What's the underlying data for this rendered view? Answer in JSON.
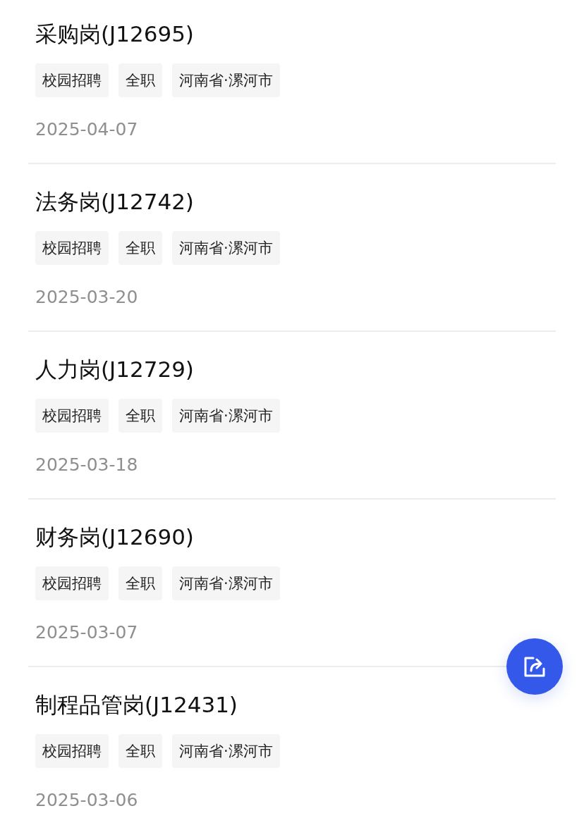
{
  "jobs": [
    {
      "title": "采购岗(J12695)",
      "tags": [
        "校园招聘",
        "全职",
        "河南省·漯河市"
      ],
      "date": "2025-04-07"
    },
    {
      "title": "法务岗(J12742)",
      "tags": [
        "校园招聘",
        "全职",
        "河南省·漯河市"
      ],
      "date": "2025-03-20"
    },
    {
      "title": "人力岗(J12729)",
      "tags": [
        "校园招聘",
        "全职",
        "河南省·漯河市"
      ],
      "date": "2025-03-18"
    },
    {
      "title": "财务岗(J12690)",
      "tags": [
        "校园招聘",
        "全职",
        "河南省·漯河市"
      ],
      "date": "2025-03-07"
    },
    {
      "title": "制程品管岗(J12431)",
      "tags": [
        "校园招聘",
        "全职",
        "河南省·漯河市"
      ],
      "date": "2025-03-06"
    }
  ]
}
